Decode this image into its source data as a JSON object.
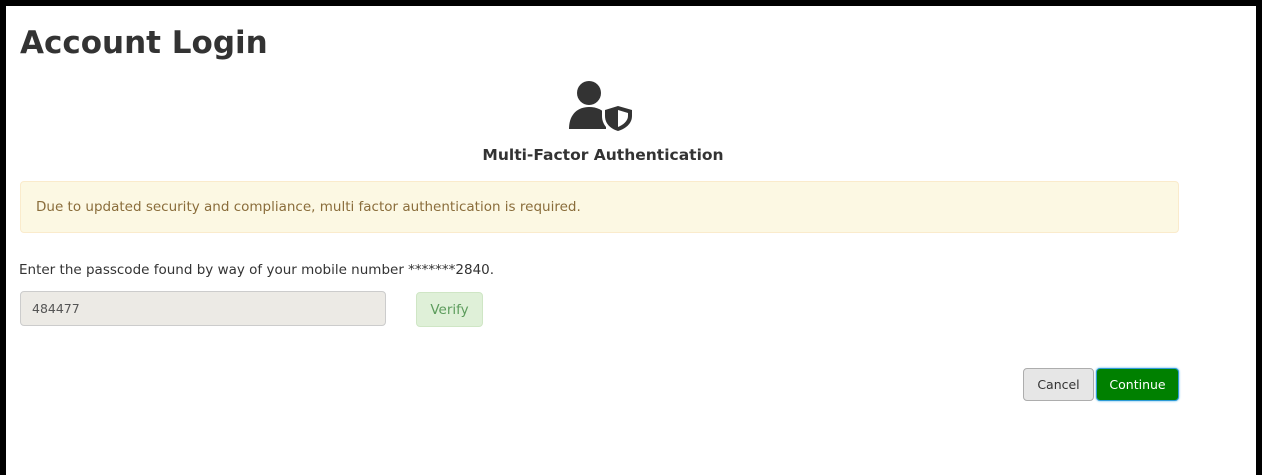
{
  "page": {
    "title": "Account Login"
  },
  "mfa": {
    "icon": "user-shield-icon",
    "heading": "Multi-Factor Authentication",
    "alert_text": "Due to updated security and compliance, multi factor authentication is required.",
    "instructions": "Enter the passcode found by way of your mobile number *******2840.",
    "passcode_value": "484477",
    "verify_label": "Verify"
  },
  "actions": {
    "cancel_label": "Cancel",
    "continue_label": "Continue"
  },
  "colors": {
    "alert_background": "#fcf8e3",
    "alert_text": "#8a6d3b",
    "verify_background": "#dff0d8",
    "continue_background": "#008000",
    "icon": "#333333"
  }
}
